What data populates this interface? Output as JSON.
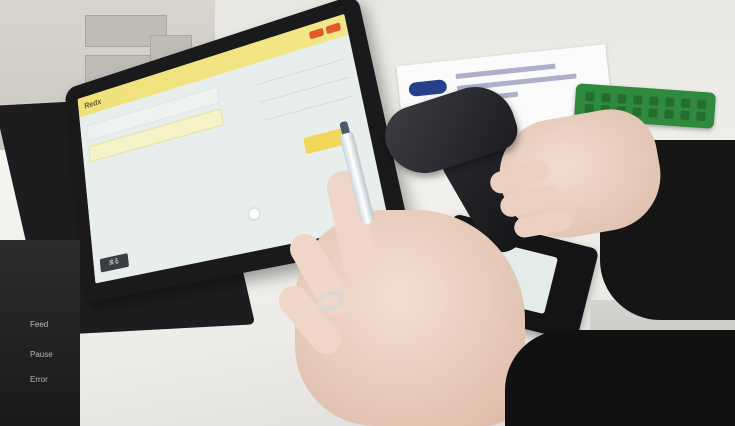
{
  "scene": "photo",
  "tablet_screen": {
    "app_title": "Redx",
    "back_button": "戻る"
  },
  "printer_labels": [
    "Feed",
    "Pause",
    "Error"
  ],
  "colors": {
    "screen_bg": "#e8eeec",
    "title_bar": "#efe17a",
    "accent_button": "#f1d85a",
    "scanner": "#1b1c1f",
    "green_case": "#2f8a3e"
  }
}
